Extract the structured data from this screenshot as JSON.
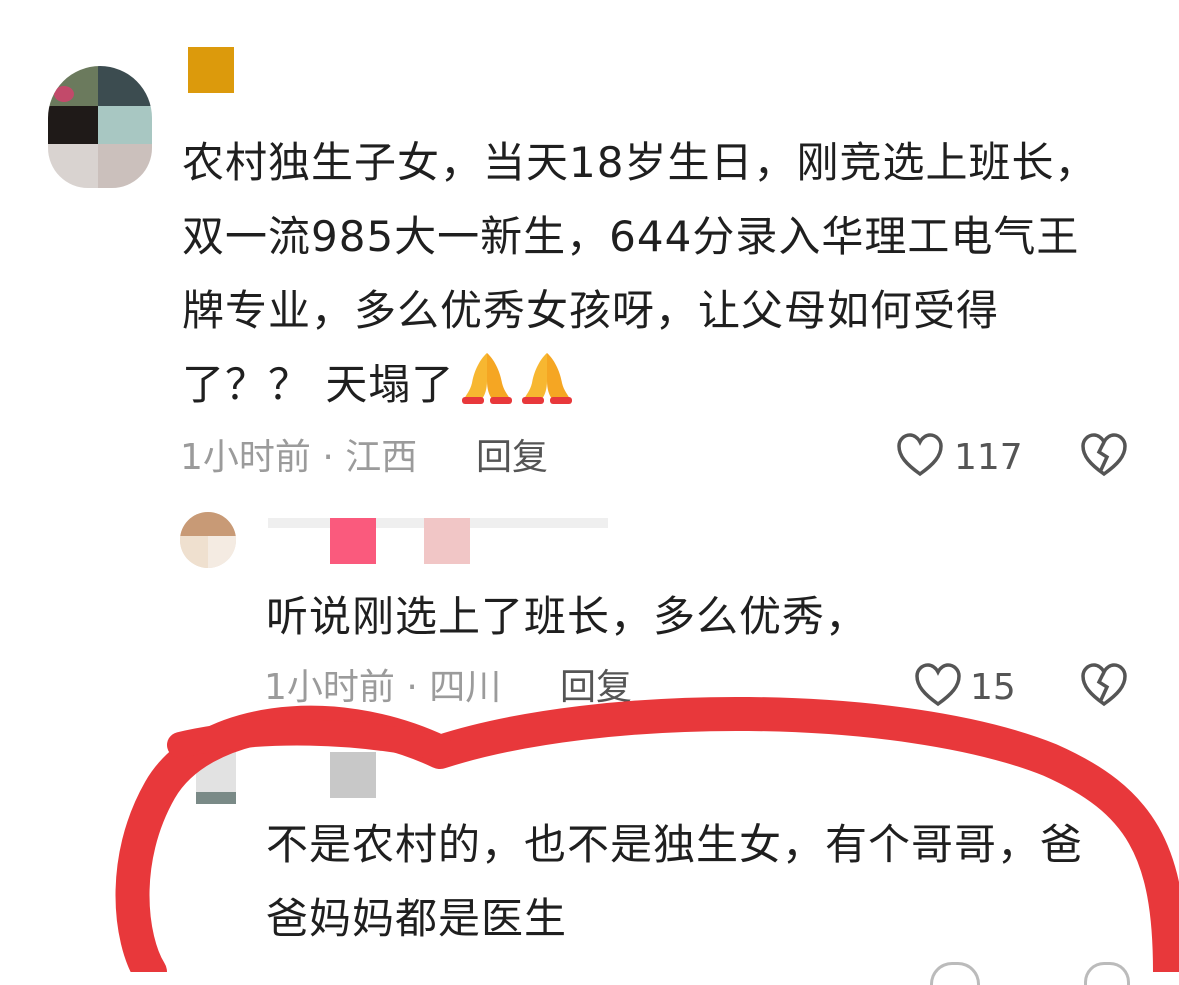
{
  "comment1": {
    "text": "农村独生子女，当天18岁生日，刚竞选上班长，双一流985大一新生，644分录入华理工电气王牌专业，多么优秀女孩呀，让父母如何受得了？？天塌了",
    "lines": [
      "农村独生子女，当天18岁生日，刚竞选上班长，",
      "双一流985大一新生，644分录入华理工电气王",
      "牌专业，多么优秀女孩呀，让父母如何受得",
      "了？？ 天塌了"
    ],
    "emoji": [
      "pray-emoji",
      "pray-emoji"
    ],
    "meta": "1小时前 · 江西",
    "reply_label": "回复",
    "likes": "117"
  },
  "reply1": {
    "text": "听说刚选上了班长，多么优秀，",
    "meta": "1小时前 · 四川",
    "reply_label": "回复",
    "likes": "15"
  },
  "reply2": {
    "lines": [
      "不是农村的，也不是独生女，有个哥哥，爸",
      "爸妈妈都是医生"
    ],
    "text": "不是农村的，也不是独生女，有个哥哥，爸爸妈妈都是医生"
  },
  "colors": {
    "highlight_circle": "#e8383b",
    "name_block_1": "#dc9a0c",
    "name_block_reply1_a": "#fa5a7d",
    "name_block_reply1_b": "#f1c6c6",
    "name_block_reply2": "#c8c8c8"
  },
  "icons": [
    "heart-icon",
    "broken-heart-icon"
  ]
}
